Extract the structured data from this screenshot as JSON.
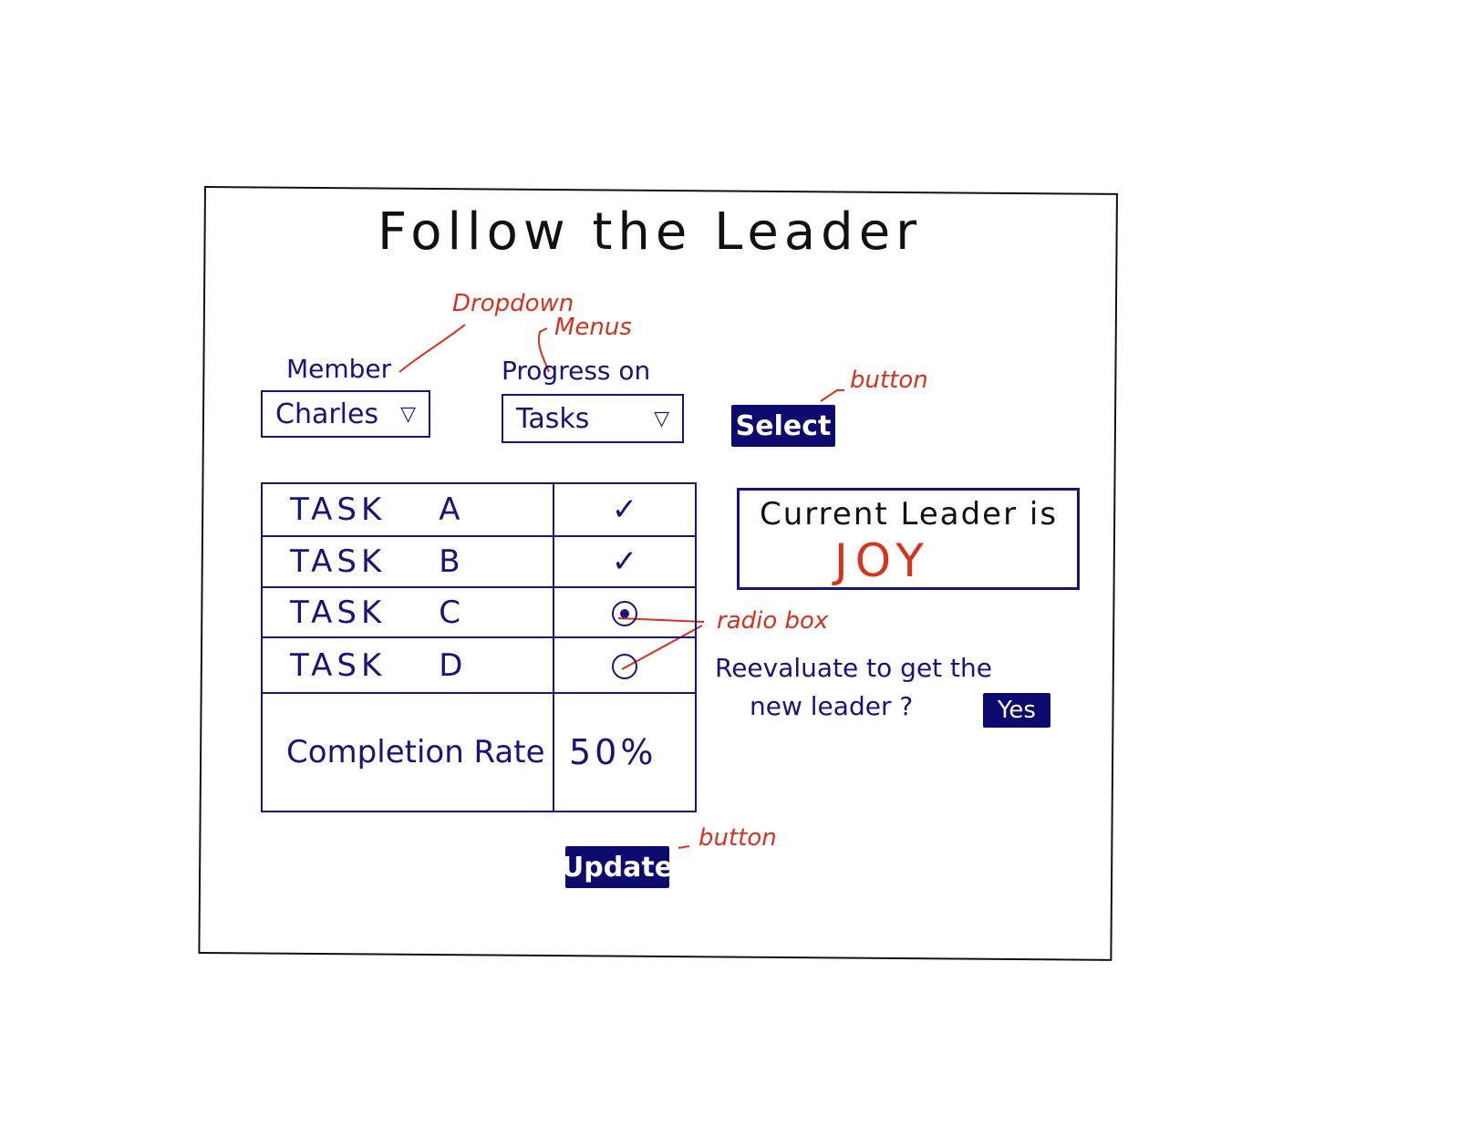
{
  "app": {
    "title": "Follow the Leader"
  },
  "member": {
    "label": "Member",
    "selected": "Charles"
  },
  "progress": {
    "label": "Progress on",
    "selected": "Tasks"
  },
  "select_button": {
    "label": "Select"
  },
  "tasks": [
    {
      "name": "TASK",
      "letter": "A",
      "status": "✓"
    },
    {
      "name": "TASK",
      "letter": "B",
      "status": "✓"
    },
    {
      "name": "TASK",
      "letter": "C",
      "status": "radio-checked"
    },
    {
      "name": "TASK",
      "letter": "D",
      "status": "radio-empty"
    }
  ],
  "completion": {
    "label": "Completion Rate",
    "value": "50%"
  },
  "leader": {
    "text": "Current Leader is",
    "name": "JOY"
  },
  "reevaluate": {
    "line1": "Reevaluate to get the",
    "line2": "new leader ?",
    "yes_label": "Yes"
  },
  "update_button": {
    "label": "Update"
  },
  "annotations": {
    "dropdown": "Dropdown",
    "menus": "Menus",
    "button_select": "button",
    "button_update": "button",
    "radio": "radio box"
  },
  "colors": {
    "ink": "#17147a",
    "button_bg": "#0c0a6e",
    "annotation": "#d8321f",
    "leader_name": "#d8321f"
  },
  "icons": {
    "dropdown_arrow": "triangle-down-icon",
    "check": "checkmark-icon",
    "radio": "radio-icon"
  }
}
